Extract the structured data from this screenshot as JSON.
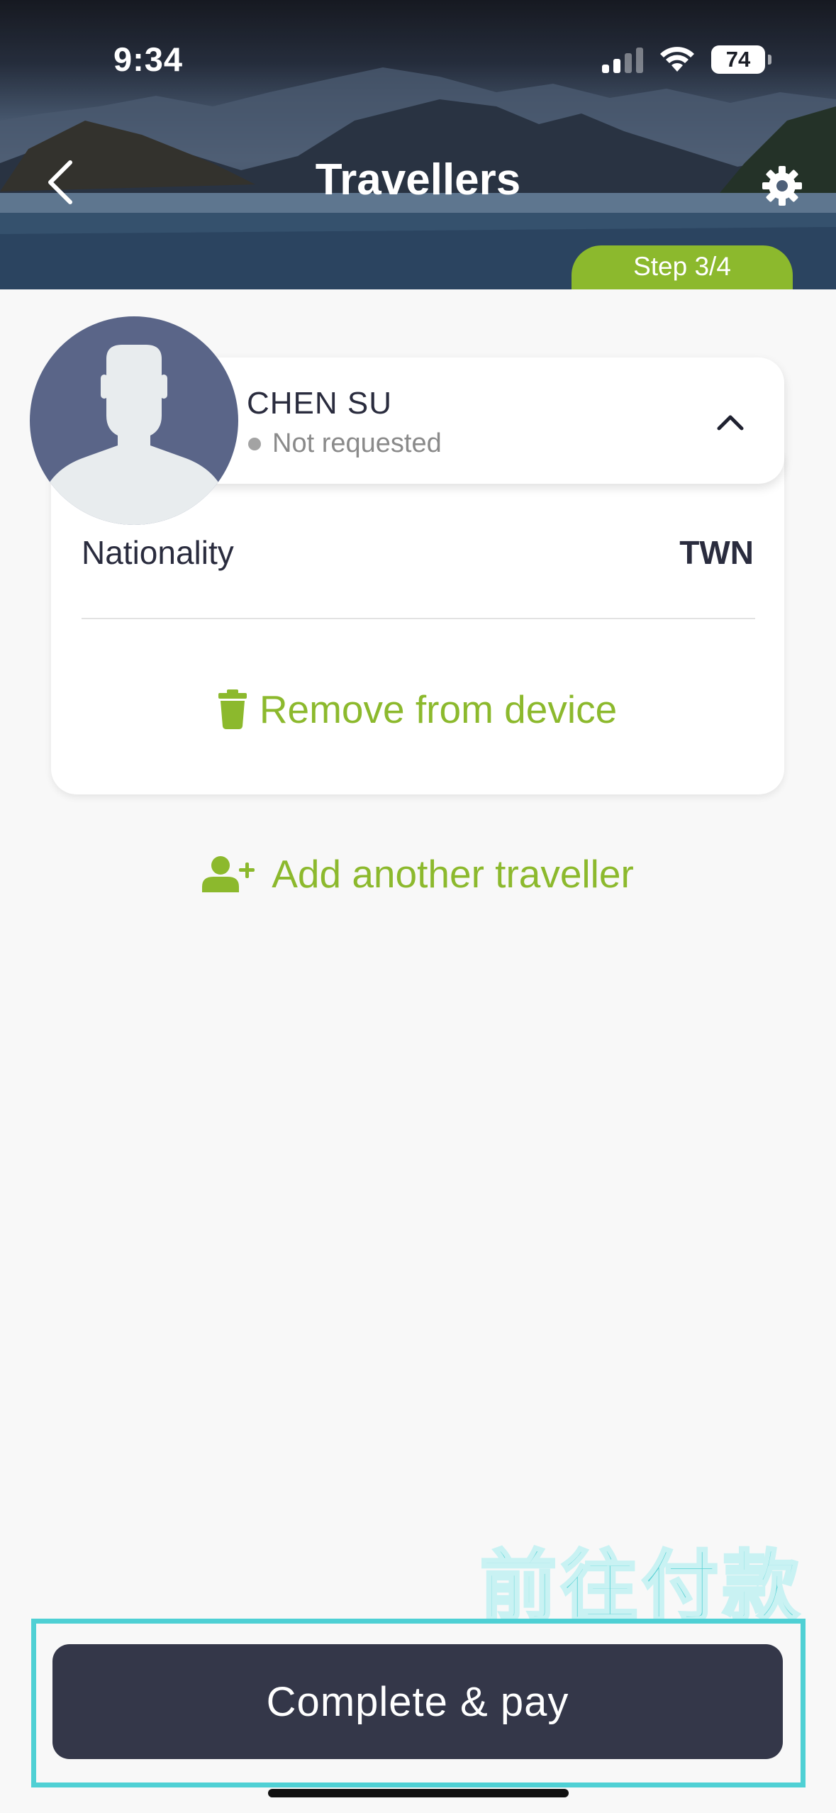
{
  "status_bar": {
    "time": "9:34",
    "battery": "74"
  },
  "header": {
    "title": "Travellers",
    "step": "Step 3/4",
    "back_icon": "chevron-left-icon",
    "settings_icon": "gear-icon"
  },
  "traveller": {
    "name": "CHEN SU",
    "status": "Not requested",
    "nationality_label": "Nationality",
    "nationality_value": "TWN",
    "remove_label": "Remove from device"
  },
  "add_traveller_label": "Add another traveller",
  "annotation": "前往付款",
  "primary_button": "Complete & pay",
  "colors": {
    "accent_green": "#8cb92d",
    "button_dark": "#343749",
    "highlight_cyan": "#4fd0d4",
    "avatar_bg": "#5a6588"
  }
}
